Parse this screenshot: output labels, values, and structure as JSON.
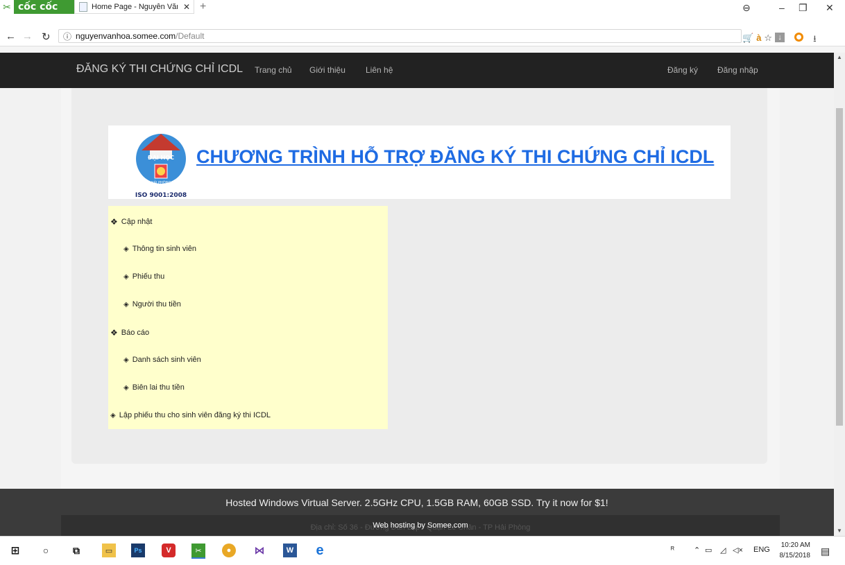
{
  "browser": {
    "brand": "cốc cốc",
    "tab_title": "Home Page - Nguyễn Văn",
    "url_host": "nguyenvanhoa.somee.com",
    "url_path": "/Default"
  },
  "navbar": {
    "brand": "ĐĂNG KÝ THI CHỨNG CHỈ ICDL",
    "links": [
      "Trang chủ",
      "Giới thiệu",
      "Liên hệ"
    ],
    "right_links": [
      "Đăng ký",
      "Đăng nhập"
    ]
  },
  "banner": {
    "title": "CHƯƠNG TRÌNH HỖ TRỢ ĐĂNG KÝ THI CHỨNG CHỈ ICDL",
    "logo_text_top": "ĐẠI HỌC",
    "logo_text_bottom": "HẢI PHÒNG",
    "logo_iso": "ISO 9001:2008"
  },
  "menu": {
    "items": [
      "Cập nhật",
      "Thông tin sinh viên",
      "Phiếu thu",
      "Người thu tiền",
      "Báo cáo",
      "Danh sách sinh viên",
      "Biên lai thu tiền",
      "Lập phiếu thu cho sinh viên đăng ký thi ICDL"
    ]
  },
  "footer": {
    "ad": "Hosted Windows Virtual Server. 2.5GHz CPU, 1.5GB RAM, 60GB SSD. Try it now for $1!",
    "address": "Địa chỉ: Số 36 - Đường Dân Lập - Quận Lê Chân - TP Hải Phòng",
    "host": "Web hosting by Somee.com"
  },
  "taskbar": {
    "lang": "ENG",
    "time": "10:20 AM",
    "date": "8/15/2018"
  },
  "colors": {
    "navbar_bg": "#222222",
    "banner_title": "#1e6be3",
    "menu_bg": "#ffffcc",
    "footer_bg": "#3b3b3b"
  }
}
